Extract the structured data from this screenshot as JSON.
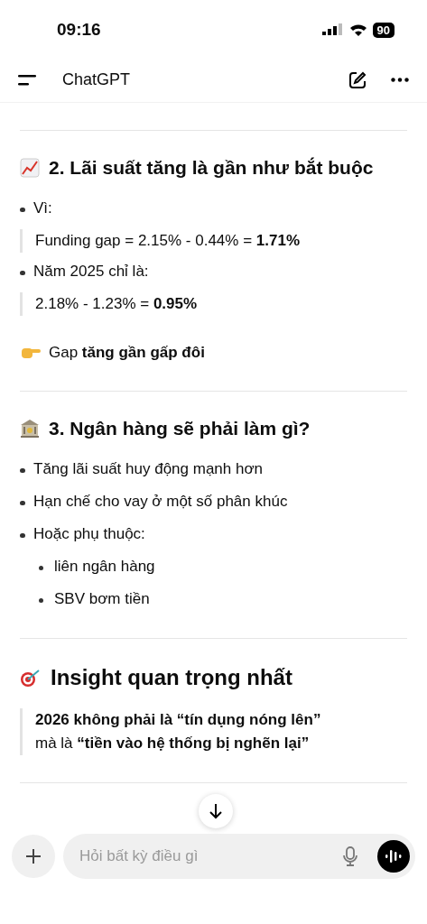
{
  "status_bar": {
    "time": "09:16",
    "battery": "90"
  },
  "header": {
    "title": "ChatGPT"
  },
  "blocks": [
    {
      "kind": "divider"
    },
    {
      "kind": "heading",
      "text": "2. Lãi suất tăng là gần như bắt buộc"
    },
    {
      "kind": "bullet",
      "text": "Vì:"
    },
    {
      "kind": "quote",
      "lines": [
        "Funding gap = 2.15% - 0.44% = **1.71%**"
      ]
    },
    {
      "kind": "bullet",
      "text": "Năm 2025 chỉ là:"
    },
    {
      "kind": "quote",
      "lines": [
        "2.18% - 1.23% = **0.95%**"
      ]
    },
    {
      "kind": "paragraph",
      "text": "Gap **tăng gần gấp đôi**"
    },
    {
      "kind": "divider"
    },
    {
      "kind": "heading",
      "text": "3. Ngân hàng sẽ phải làm gì?"
    },
    {
      "kind": "bullet",
      "text": "Tăng lãi suất huy động mạnh hơn"
    },
    {
      "kind": "bullet",
      "text": "Hạn chế cho vay ở một số phân khúc"
    },
    {
      "kind": "bullet",
      "text": "Hoặc phụ thuộc:"
    },
    {
      "kind": "subbullet",
      "text": "liên ngân hàng"
    },
    {
      "kind": "subbullet",
      "text": "SBV bơm tiền"
    },
    {
      "kind": "divider"
    },
    {
      "kind": "heading",
      "text": "Insight quan trọng nhất"
    },
    {
      "kind": "quote",
      "lines": [
        "**2026 không phải là “tín dụng nóng lên”**",
        "mà là **“tiền vào hệ thống bị nghẽn lại”**"
      ]
    },
    {
      "kind": "divider"
    }
  ],
  "composer": {
    "placeholder": "Hỏi bất kỳ điều gì"
  }
}
